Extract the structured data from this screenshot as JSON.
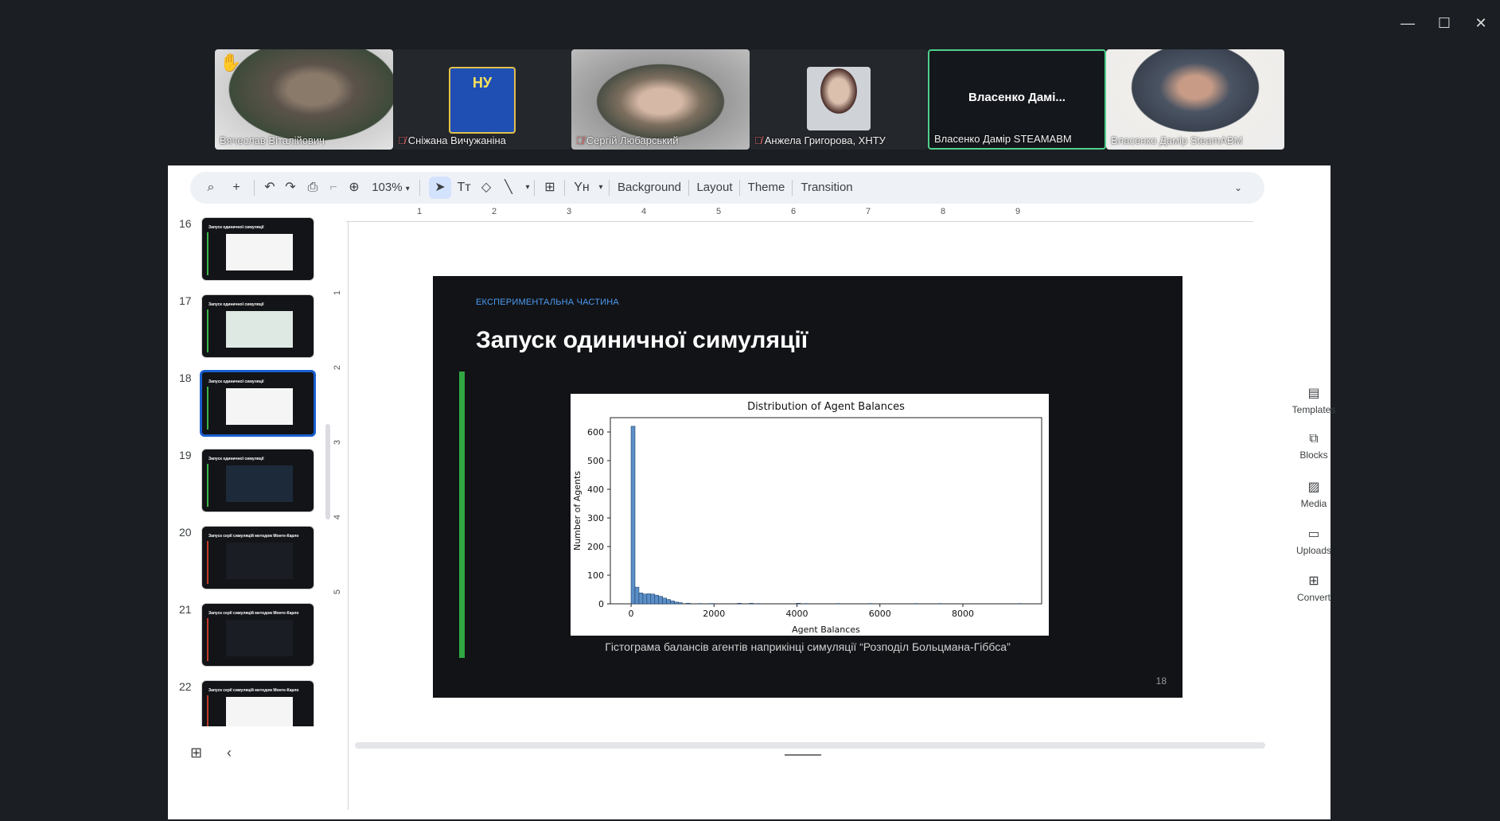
{
  "window": {
    "controls": {
      "minimize": "—",
      "maximize": "☐",
      "close": "✕"
    }
  },
  "participants": [
    {
      "name": "Вячеслав Віталійович",
      "hand": "✋",
      "muted": false
    },
    {
      "name": "Сніжана Вичужаніна",
      "muted": true,
      "avatar_text": "НУ"
    },
    {
      "name": "Сергій Любарський",
      "muted": true
    },
    {
      "name": "Анжела Григорова, ХНТУ",
      "muted": true
    },
    {
      "name": "Власенко Дамір STEAMABM",
      "muted": false,
      "center_label": "Власенко  Дамі..."
    },
    {
      "name": "Власенко Дамір SteamABM",
      "muted": false
    }
  ],
  "toolbar": {
    "zoom": "103%",
    "background": "Background",
    "layout": "Layout",
    "theme": "Theme",
    "transition": "Transition"
  },
  "ruler": {
    "h": [
      "1",
      "2",
      "3",
      "4",
      "5",
      "6",
      "7",
      "8",
      "9"
    ],
    "v": [
      "1",
      "2",
      "3",
      "4",
      "5"
    ]
  },
  "filmstrip": [
    {
      "num": "16",
      "title": "Запуск одиничної симуляції"
    },
    {
      "num": "17",
      "title": "Запуск одиничної симуляції"
    },
    {
      "num": "18",
      "title": "Запуск одиничної симуляції"
    },
    {
      "num": "19",
      "title": "Запуск одиничної симуляції"
    },
    {
      "num": "20",
      "title": "Запуск серії симуляцій методом Монте-Карло"
    },
    {
      "num": "21",
      "title": "Запуск серії симуляцій методом Монте-Карло"
    },
    {
      "num": "22",
      "title": "Запуск серії симуляцій методом Монте-Карло"
    }
  ],
  "side_panel": [
    {
      "label": "Templates",
      "icon": "▤"
    },
    {
      "label": "Blocks",
      "icon": "⧉"
    },
    {
      "label": "Media",
      "icon": "▨"
    },
    {
      "label": "Uploads",
      "icon": "▭"
    },
    {
      "label": "Convert",
      "icon": "⊞"
    }
  ],
  "slide": {
    "kicker": "ЕКСПЕРИМЕНТАЛЬНА ЧАСТИНА",
    "title": "Запуск одиничної симуляції",
    "caption": "Гістограма балансів агентів наприкінці симуляції “Розподіл Больцмана-Гіббса”",
    "page_number": "18"
  },
  "chart_data": {
    "type": "bar",
    "title": "Distribution of Agent Balances",
    "xlabel": "Agent Balances",
    "ylabel": "Number of Agents",
    "xticks": [
      0,
      2000,
      4000,
      6000,
      8000
    ],
    "yticks": [
      0,
      100,
      200,
      300,
      400,
      500,
      600
    ],
    "xlim": [
      -500,
      9900
    ],
    "ylim": [
      0,
      650
    ],
    "bin_width": 95,
    "bins": [
      {
        "x": 0,
        "count": 620
      },
      {
        "x": 95,
        "count": 58
      },
      {
        "x": 190,
        "count": 38
      },
      {
        "x": 285,
        "count": 34
      },
      {
        "x": 380,
        "count": 35
      },
      {
        "x": 475,
        "count": 34
      },
      {
        "x": 570,
        "count": 30
      },
      {
        "x": 665,
        "count": 26
      },
      {
        "x": 760,
        "count": 20
      },
      {
        "x": 855,
        "count": 15
      },
      {
        "x": 950,
        "count": 10
      },
      {
        "x": 1045,
        "count": 6
      },
      {
        "x": 1140,
        "count": 4
      },
      {
        "x": 1330,
        "count": 2
      },
      {
        "x": 1615,
        "count": 1
      },
      {
        "x": 1900,
        "count": 1
      },
      {
        "x": 2565,
        "count": 2
      },
      {
        "x": 2850,
        "count": 2
      },
      {
        "x": 3040,
        "count": 1
      },
      {
        "x": 3990,
        "count": 2
      },
      {
        "x": 4180,
        "count": 1
      },
      {
        "x": 4940,
        "count": 1
      },
      {
        "x": 5700,
        "count": 1
      },
      {
        "x": 6840,
        "count": 1
      },
      {
        "x": 7410,
        "count": 1
      },
      {
        "x": 9310,
        "count": 1
      }
    ]
  }
}
